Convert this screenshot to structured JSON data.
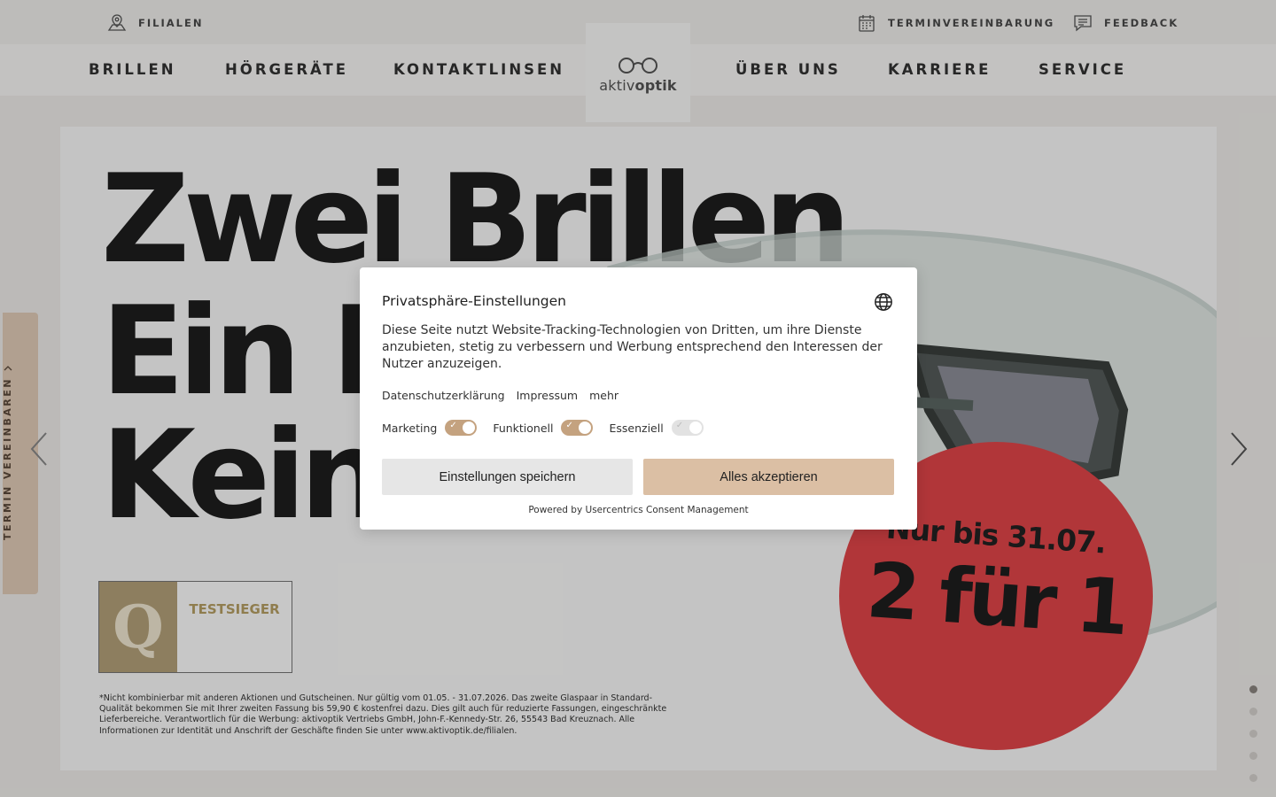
{
  "topbar": {
    "filialen": "FILIALEN",
    "termin": "TERMINVEREINBARUNG",
    "feedback": "FEEDBACK"
  },
  "nav": {
    "items": [
      "BRILLEN",
      "HÖRGERÄTE",
      "KONTAKTLINSEN",
      "ÜBER UNS",
      "KARRIERE",
      "SERVICE"
    ],
    "logo_light": "aktiv",
    "logo_bold": "optik"
  },
  "hero": {
    "line1": "Zwei Brillen",
    "line2": "Ein P",
    "line3": "Kein",
    "promo_line1": "Nur bis 31.07.",
    "promo_line2": "2 für 1",
    "badge_title": "TESTSIEGER",
    "badge_q": "Q",
    "footnote": "*Nicht kombinierbar mit anderen Aktionen und Gutscheinen. Nur gültig vom 01.05. - 31.07.2026. Das zweite Glaspaar in Standard-Qualität bekommen Sie mit Ihrer zweiten Fassung bis 59,90 € kostenfrei dazu. Dies gilt auch für reduzierte Fassungen, eingeschränkte Lieferbereiche. Verantwortlich für die Werbung: aktivoptik Vertriebs GmbH, John-F.-Kennedy-Str. 26, 55543 Bad Kreuznach. Alle Informationen zur Identität und Anschrift der Geschäfte finden Sie unter www.aktivoptik.de/filialen.",
    "side_tab": "TERMIN VEREINBAREN",
    "active_slide": 1,
    "slide_count": 5
  },
  "consent": {
    "title": "Privatsphäre-Einstellungen",
    "body": "Diese Seite nutzt Website-Tracking-Technologien von Dritten, um ihre Dienste anzubieten, stetig zu verbessern und Werbung entsprechend den Interessen der Nutzer anzuzeigen.",
    "links": [
      "Datenschutzerklärung",
      "Impressum",
      "mehr"
    ],
    "toggles": [
      {
        "label": "Marketing",
        "on": true
      },
      {
        "label": "Funktionell",
        "on": true
      },
      {
        "label": "Essenziell",
        "on": true,
        "disabled": true
      }
    ],
    "save_label": "Einstellungen speichern",
    "accept_label": "Alles akzeptieren",
    "powered_by": "Powered by Usercentrics Consent Management"
  },
  "colors": {
    "accent": "#c4a27f",
    "accept_button": "#dbbfa4",
    "promo_red": "#e3464a"
  }
}
